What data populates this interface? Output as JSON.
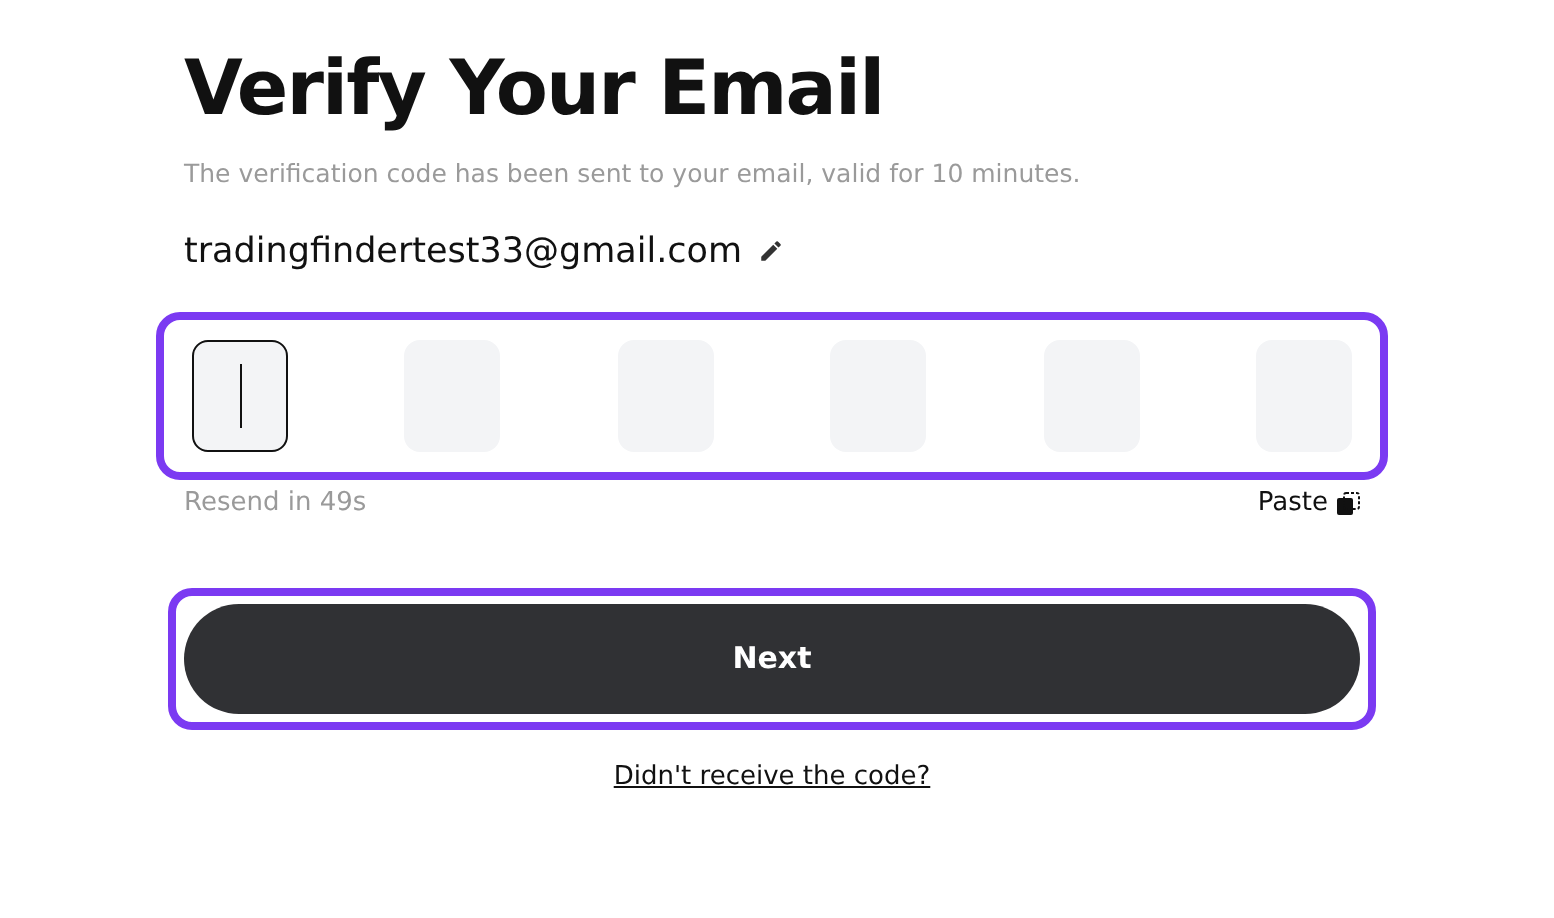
{
  "title": "Verify Your Email",
  "subtitle": "The verification code has been sent to your email, valid for 10 minutes.",
  "email": "tradingfindertest33@gmail.com",
  "code_input": {
    "highlighted": true,
    "cells": [
      {
        "focused": true
      },
      {
        "focused": false
      },
      {
        "focused": false
      },
      {
        "focused": false
      },
      {
        "focused": false
      },
      {
        "focused": false
      }
    ]
  },
  "resend": "Resend in 49s",
  "paste": "Paste",
  "next_button": {
    "label": "Next",
    "highlighted": true
  },
  "help_link": "Didn't receive the code?"
}
